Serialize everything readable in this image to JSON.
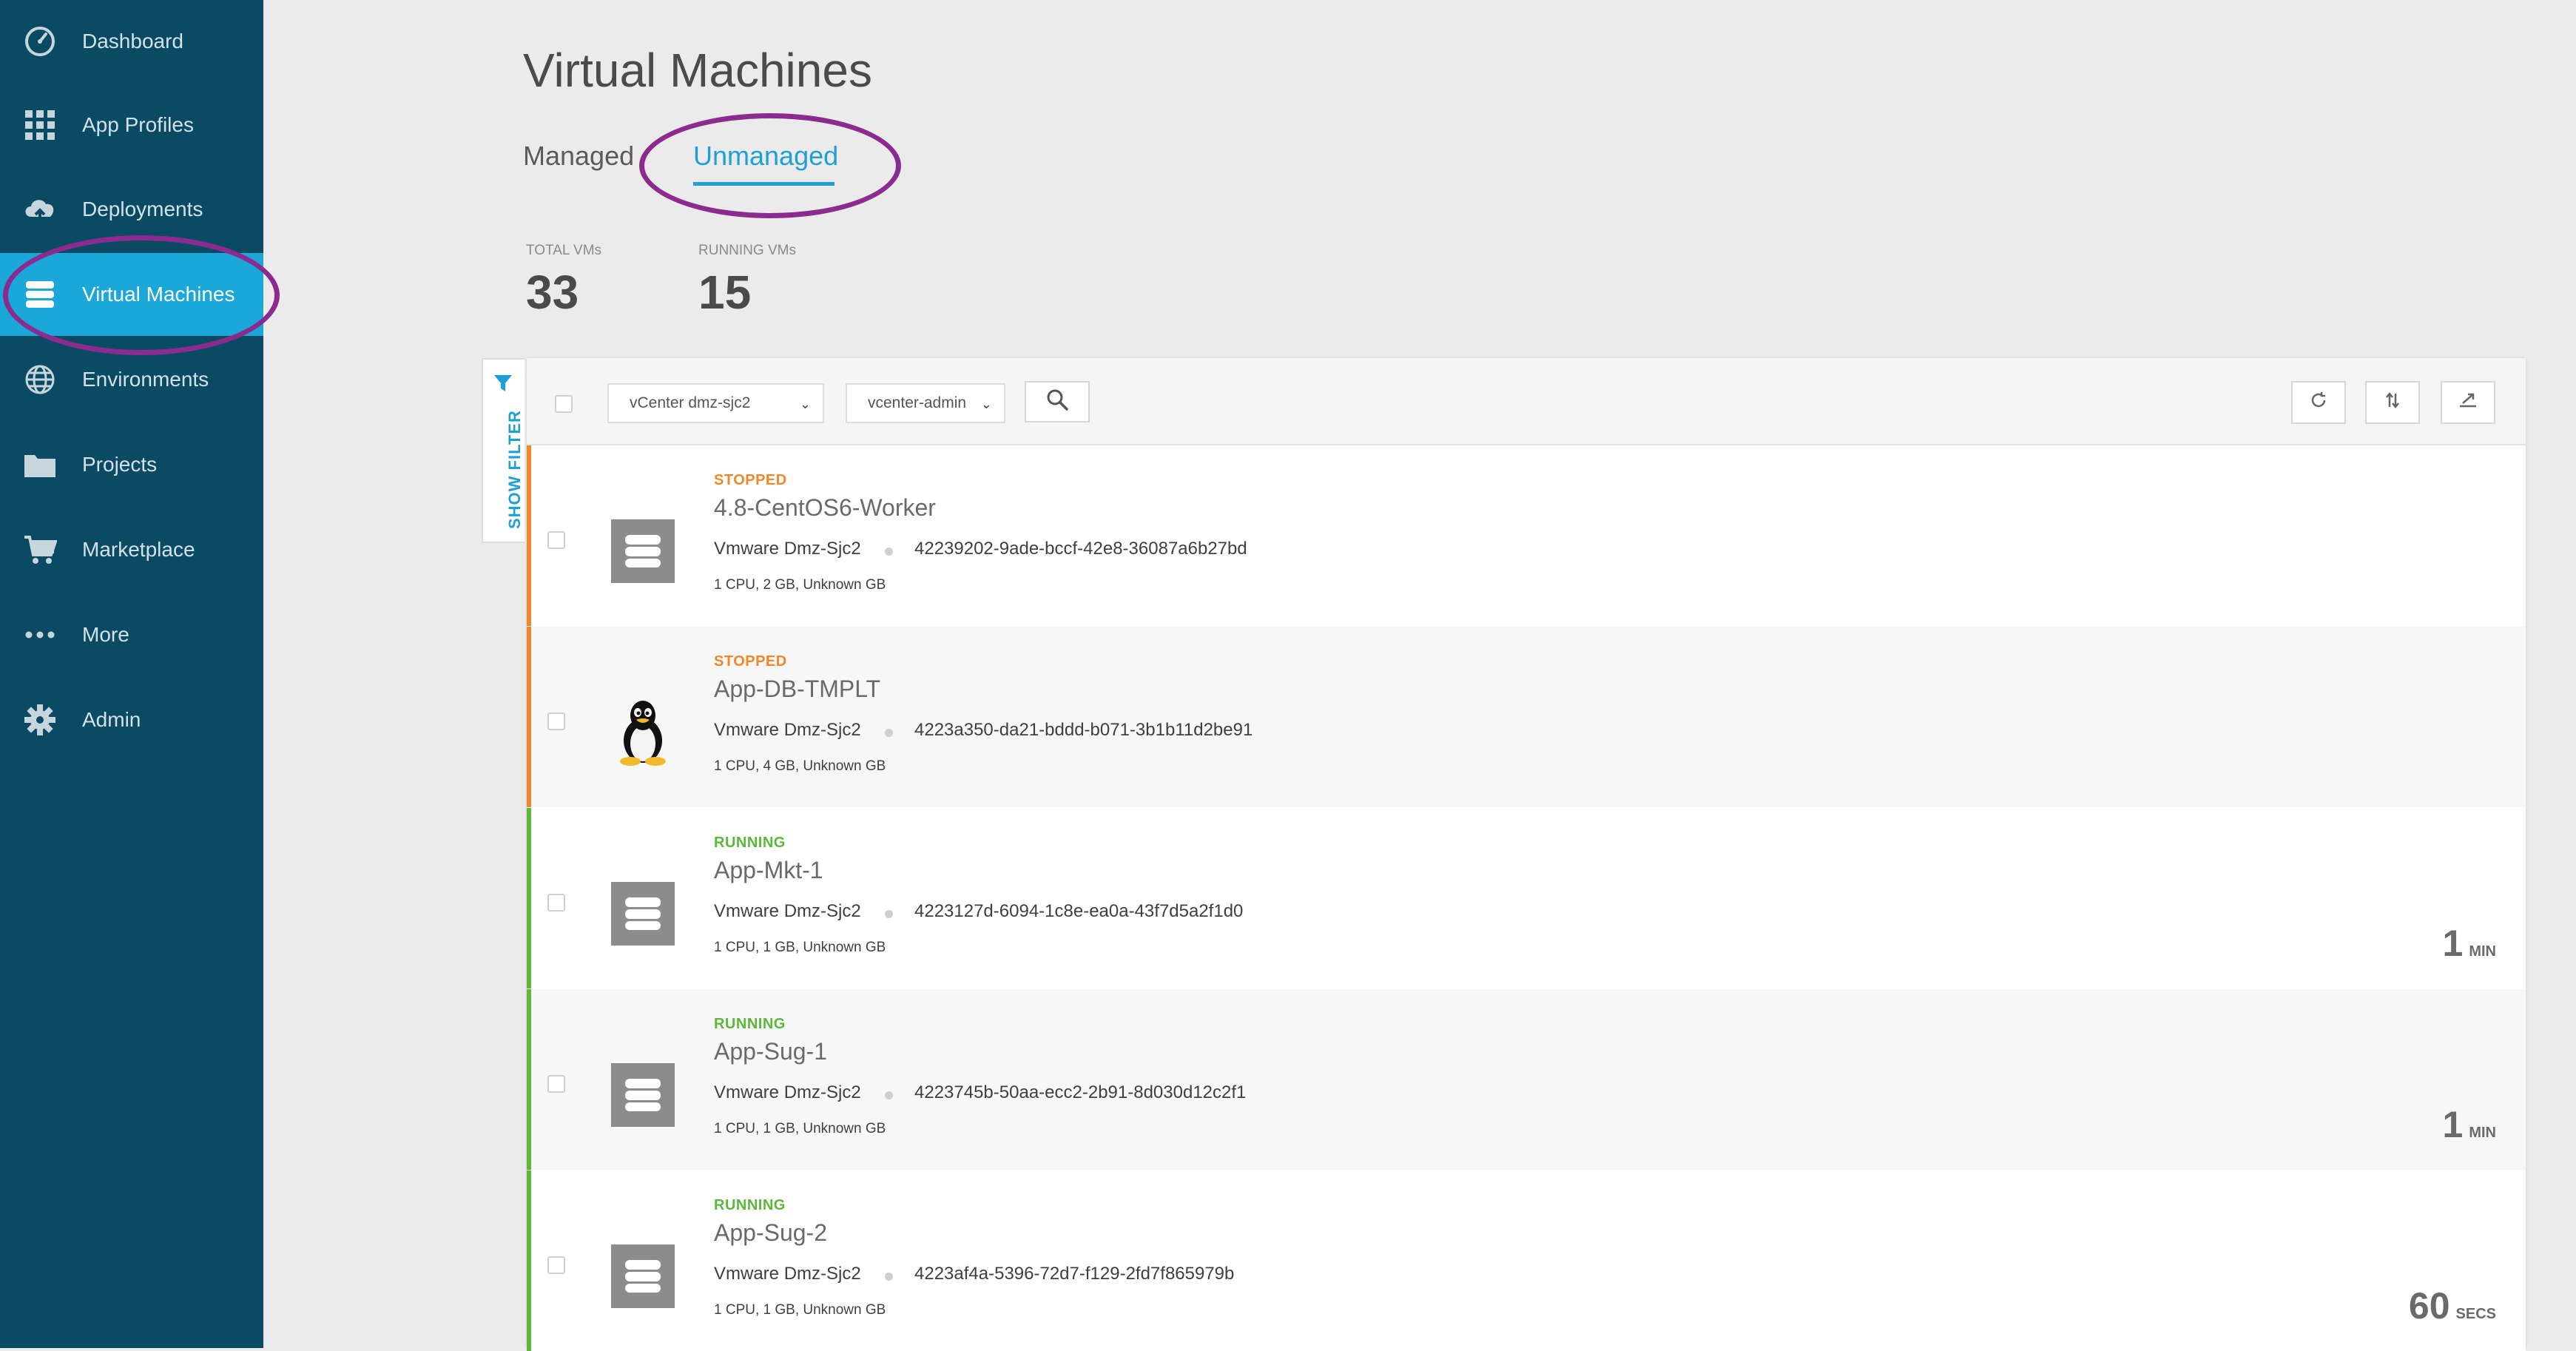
{
  "sidebar": {
    "items": [
      {
        "label": "Dashboard",
        "icon": "dashboard-icon"
      },
      {
        "label": "App Profiles",
        "icon": "grid-icon"
      },
      {
        "label": "Deployments",
        "icon": "cloud-upload-icon"
      },
      {
        "label": "Virtual Machines",
        "icon": "stack-icon",
        "active": true
      },
      {
        "label": "Environments",
        "icon": "globe-icon"
      },
      {
        "label": "Projects",
        "icon": "folder-icon"
      },
      {
        "label": "Marketplace",
        "icon": "cart-icon"
      },
      {
        "label": "More",
        "icon": "more-dots-icon"
      },
      {
        "label": "Admin",
        "icon": "gear-icon"
      }
    ]
  },
  "header": {
    "title": "Virtual Machines",
    "tabs": [
      {
        "label": "Managed",
        "active": false
      },
      {
        "label": "Unmanaged",
        "active": true
      }
    ]
  },
  "stats": {
    "total_label": "TOTAL VMs",
    "total_value": "33",
    "running_label": "RUNNING VMs",
    "running_value": "15"
  },
  "toolbar": {
    "filter_label": "SHOW FILTER",
    "cloud_select": "vCenter dmz-sjc2",
    "account_select": "vcenter-admin"
  },
  "colors": {
    "sidebar_bg": "#0b4a63",
    "accent": "#1fa0d4",
    "stopped": "#f0882a",
    "running": "#5cb83a",
    "annotation": "#8c2b8f"
  },
  "vms": [
    {
      "status": "STOPPED",
      "name": "4.8-CentOS6-Worker",
      "host": "Vmware Dmz-Sjc2",
      "uuid": "42239202-9ade-bccf-42e8-36087a6b27bd",
      "spec": "1 CPU, 2 GB, Unknown GB",
      "icon": "server-stack-icon",
      "uptime_num": "",
      "uptime_unit": ""
    },
    {
      "status": "STOPPED",
      "name": "App-DB-TMPLT",
      "host": "Vmware Dmz-Sjc2",
      "uuid": "4223a350-da21-bddd-b071-3b1b11d2be91",
      "spec": "1 CPU, 4 GB, Unknown GB",
      "icon": "linux-penguin-icon",
      "uptime_num": "",
      "uptime_unit": ""
    },
    {
      "status": "RUNNING",
      "name": "App-Mkt-1",
      "host": "Vmware Dmz-Sjc2",
      "uuid": "4223127d-6094-1c8e-ea0a-43f7d5a2f1d0",
      "spec": "1 CPU, 1 GB, Unknown GB",
      "icon": "server-stack-icon",
      "uptime_num": "1",
      "uptime_unit": "MIN"
    },
    {
      "status": "RUNNING",
      "name": "App-Sug-1",
      "host": "Vmware Dmz-Sjc2",
      "uuid": "4223745b-50aa-ecc2-2b91-8d030d12c2f1",
      "spec": "1 CPU, 1 GB, Unknown GB",
      "icon": "server-stack-icon",
      "uptime_num": "1",
      "uptime_unit": "MIN"
    },
    {
      "status": "RUNNING",
      "name": "App-Sug-2",
      "host": "Vmware Dmz-Sjc2",
      "uuid": "4223af4a-5396-72d7-f129-2fd7f865979b",
      "spec": "1 CPU, 1 GB, Unknown GB",
      "icon": "server-stack-icon",
      "uptime_num": "60",
      "uptime_unit": "SECS"
    }
  ]
}
